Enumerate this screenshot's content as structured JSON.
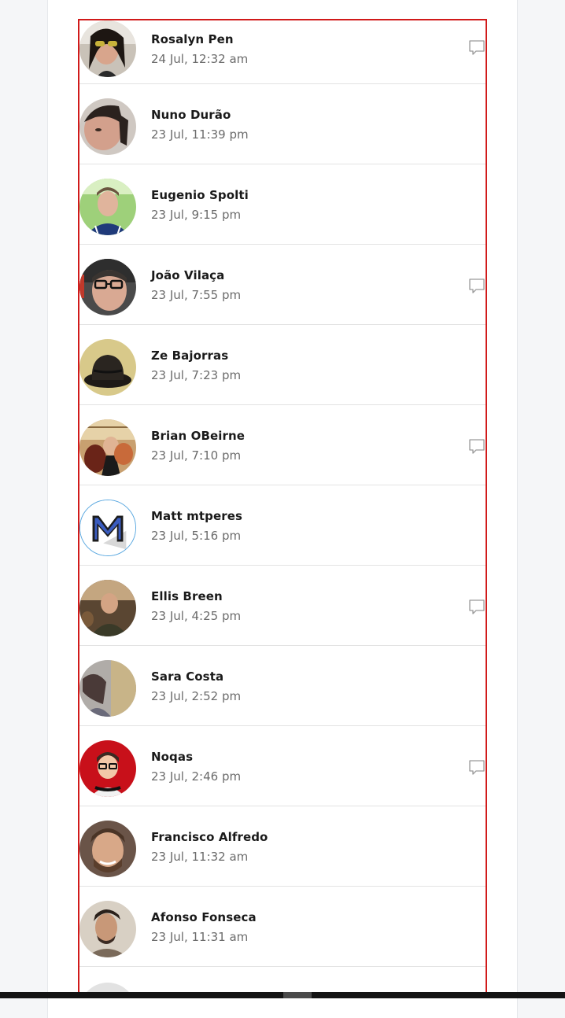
{
  "comments": [
    {
      "name": "Rosalyn Pen",
      "time": "24 Jul, 12:32 am",
      "has_comment_icon": true,
      "avatar_icon": "avatar-rosalyn-pen"
    },
    {
      "name": "Nuno Durão",
      "time": "23 Jul, 11:39 pm",
      "has_comment_icon": false,
      "avatar_icon": "avatar-nuno-durao"
    },
    {
      "name": "Eugenio Spolti",
      "time": "23 Jul, 9:15 pm",
      "has_comment_icon": false,
      "avatar_icon": "avatar-eugenio-spolti"
    },
    {
      "name": "João Vilaça",
      "time": "23 Jul, 7:55 pm",
      "has_comment_icon": true,
      "avatar_icon": "avatar-joao-vilaca"
    },
    {
      "name": "Ze Bajorras",
      "time": "23 Jul, 7:23 pm",
      "has_comment_icon": false,
      "avatar_icon": "avatar-ze-bajorras"
    },
    {
      "name": "Brian OBeirne",
      "time": "23 Jul, 7:10 pm",
      "has_comment_icon": true,
      "avatar_icon": "avatar-brian-obeirne"
    },
    {
      "name": "Matt mtperes",
      "time": "23 Jul, 5:16 pm",
      "has_comment_icon": false,
      "avatar_icon": "avatar-matt-mtperes"
    },
    {
      "name": "Ellis Breen",
      "time": "23 Jul, 4:25 pm",
      "has_comment_icon": true,
      "avatar_icon": "avatar-ellis-breen"
    },
    {
      "name": "Sara Costa",
      "time": "23 Jul, 2:52 pm",
      "has_comment_icon": false,
      "avatar_icon": "avatar-sara-costa"
    },
    {
      "name": "Noqas",
      "time": "23 Jul, 2:46 pm",
      "has_comment_icon": true,
      "avatar_icon": "avatar-noqas"
    },
    {
      "name": "Francisco Alfredo",
      "time": "23 Jul, 11:32 am",
      "has_comment_icon": false,
      "avatar_icon": "avatar-francisco-alfredo"
    },
    {
      "name": "Afonso Fonseca",
      "time": "23 Jul, 11:31 am",
      "has_comment_icon": false,
      "avatar_icon": "avatar-afonso-fonseca"
    }
  ],
  "colors": {
    "highlight_border": "#d11a1a",
    "name_text": "#1a1a1a",
    "time_text": "#6b6b6b",
    "page_background": "#f5f6f8"
  }
}
